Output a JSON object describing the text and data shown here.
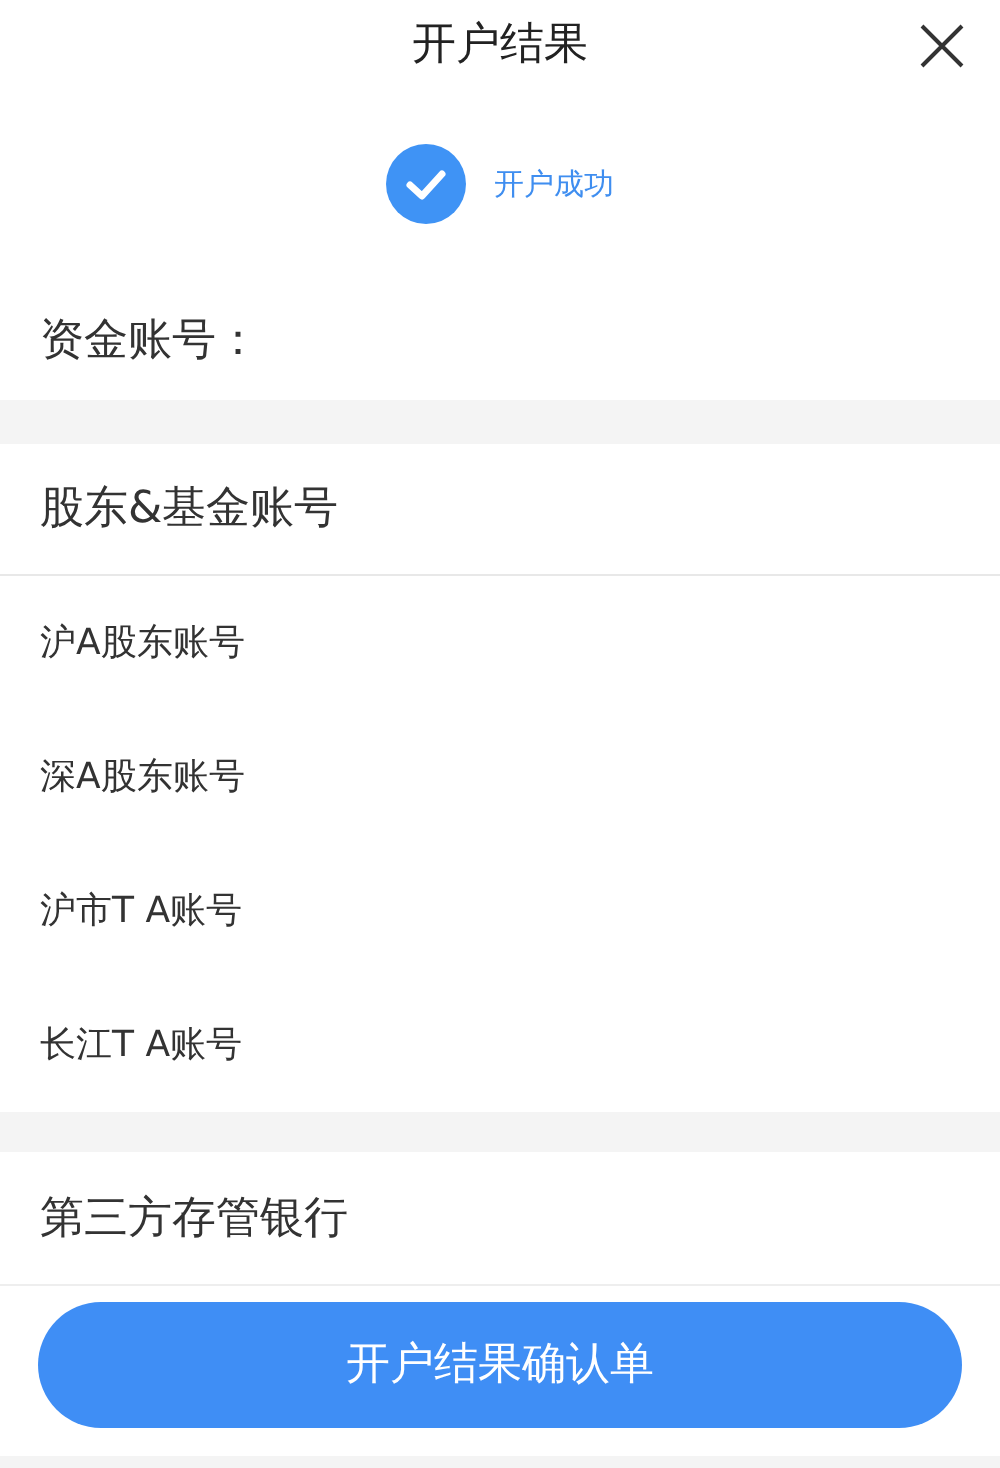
{
  "header": {
    "title": "开户结果"
  },
  "status": {
    "text": "开户成功",
    "success": true
  },
  "fund_account": {
    "label": "资金账号："
  },
  "shareholder_section": {
    "title": "股东&基金账号",
    "items": [
      {
        "label": "沪A股东账号"
      },
      {
        "label": "深A股东账号"
      },
      {
        "label": "沪市T A账号"
      },
      {
        "label": "长江T A账号"
      }
    ]
  },
  "bank_section": {
    "title": "第三方存管银行"
  },
  "confirm_button": {
    "label": "开户结果确认单"
  }
}
